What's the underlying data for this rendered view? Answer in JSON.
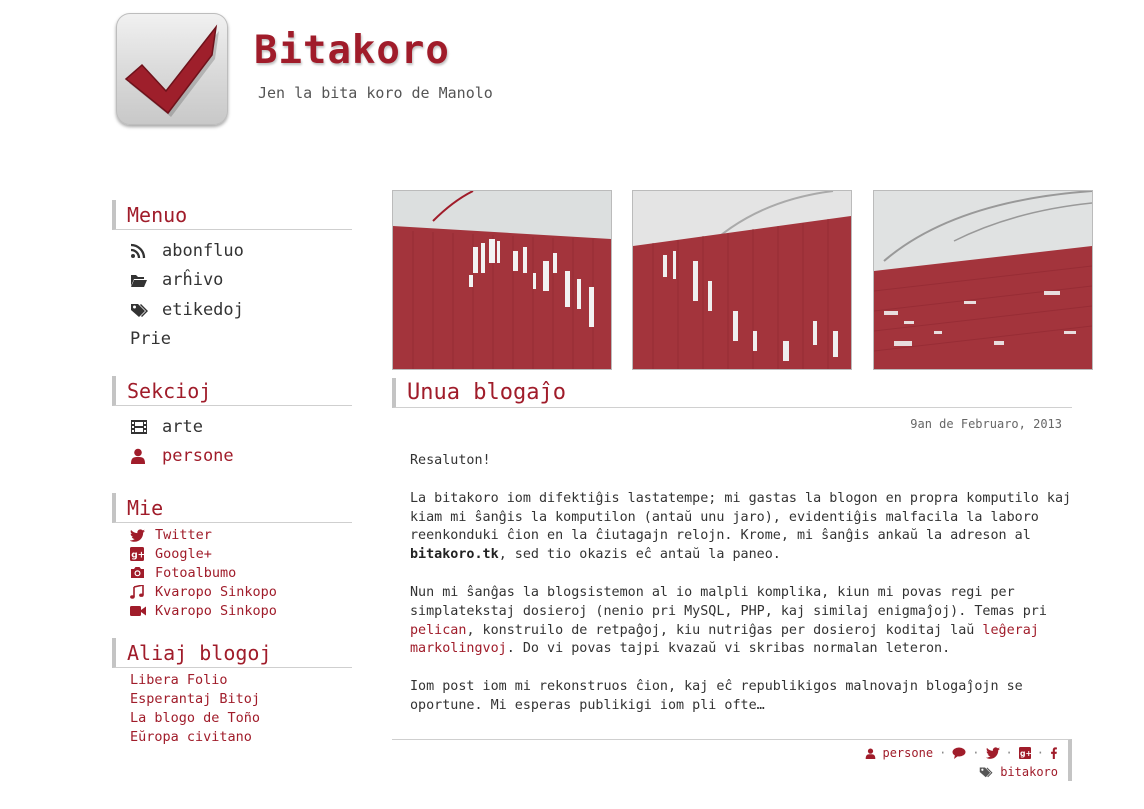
{
  "header": {
    "title": "Bitakoro",
    "subtitle": "Jen la bita koro de Manolo"
  },
  "colors": {
    "accent": "#a01c2a",
    "text": "#333333",
    "border": "#c4c4c4"
  },
  "sidebar": {
    "menuo": {
      "heading": "Menuo",
      "items": [
        {
          "label": "abonfluo",
          "icon": "rss-icon"
        },
        {
          "label": "arĥivo",
          "icon": "folder-open-icon"
        },
        {
          "label": "etikedoj",
          "icon": "tags-icon"
        },
        {
          "label": "Prie",
          "icon": ""
        }
      ]
    },
    "sekcioj": {
      "heading": "Sekcioj",
      "items": [
        {
          "label": "arte",
          "icon": "film-icon"
        },
        {
          "label": "persone",
          "icon": "user-icon"
        }
      ]
    },
    "mie": {
      "heading": "Mie",
      "items": [
        {
          "label": "Twitter",
          "icon": "twitter-icon"
        },
        {
          "label": "Google+",
          "icon": "google-plus-icon"
        },
        {
          "label": "Fotoalbumo",
          "icon": "camera-icon"
        },
        {
          "label": "Kvaropo Sinkopo",
          "icon": "music-icon"
        },
        {
          "label": "Kvaropo Sinkopo",
          "icon": "video-camera-icon"
        }
      ]
    },
    "aliaj": {
      "heading": "Aliaj blogoj",
      "items": [
        {
          "label": "Libera Folio"
        },
        {
          "label": "Esperantaj Bitoj"
        },
        {
          "label": "La blogo de Toño"
        },
        {
          "label": "Eŭropa civitano"
        }
      ]
    }
  },
  "post": {
    "title": "Unua blogaĵo",
    "date": "9an de Februaro, 2013",
    "p1": "Resaluton!",
    "p2a": "La bitakoro iom difektiĝis lastatempe; mi gastas la blogon en propra komputilo kaj kiam mi ŝanĝis la komputilon (antaŭ unu jaro), evidentiĝis malfacila la laboro reenkonduki ĉion en la ĉiutagajn relojn. Krome, mi ŝanĝis ankaŭ la adreson al ",
    "p2b": "bitakoro.tk",
    "p2c": ", sed tio okazis eĉ antaŭ la paneo.",
    "p3a": "Nun mi ŝanĝas la blogsistemon al io malpli komplika, kiun mi povas regi per simplatekstaj dosieroj (nenio pri MySQL, PHP, kaj similaj enigmaĵoj). Temas pri ",
    "p3link1": "pelican",
    "p3b": ", konstruilo de retpaĝoj, kiu nutriĝas per dosieroj koditaj laŭ ",
    "p3link2": "leĝeraj markolingvoj",
    "p3c": ". Do vi povas tajpi kvazaŭ vi skribas normalan leteron.",
    "p4": "Iom post iom mi rekonstruos ĉion, kaj eĉ republikigos malnovajn blogaĵojn se oportune. Mi esperas publikigi iom pli ofte…",
    "footer": {
      "category": "persone",
      "separator": "·",
      "tag": "bitakoro"
    }
  }
}
